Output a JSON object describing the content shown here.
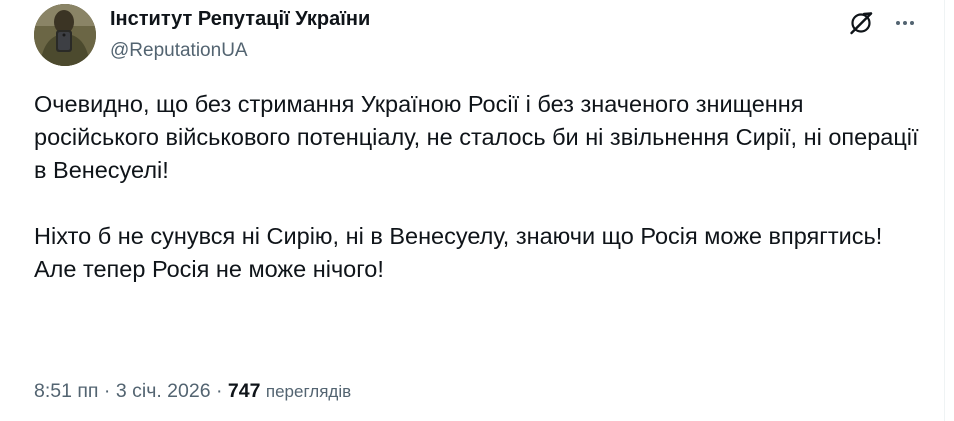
{
  "author": {
    "display_name": "Інститут Репутації України",
    "handle": "@ReputationUA"
  },
  "actions": {
    "grok_icon": "grok-icon",
    "more_icon": "more-icon"
  },
  "tweet": {
    "paragraph_1": "Очевидно, що без стримання Україною Росії і без значеного знищення російського військового потенціалу, не сталось би ні звільнення Сирії, ні операції в Венесуелі!",
    "paragraph_2_line_1": "Ніхто б не сунувся ні Сирію, ні в Венесуелу, знаючи що Росія може впрягтись!",
    "paragraph_2_line_2": "Але тепер Росія не може нічого!"
  },
  "meta": {
    "time": "8:51 пп",
    "separator": "·",
    "date": "3 січ. 2026",
    "views_count": "747",
    "views_label": "переглядів"
  },
  "colors": {
    "text_primary": "#0f1419",
    "text_secondary": "#536471",
    "divider": "#eff3f4"
  }
}
